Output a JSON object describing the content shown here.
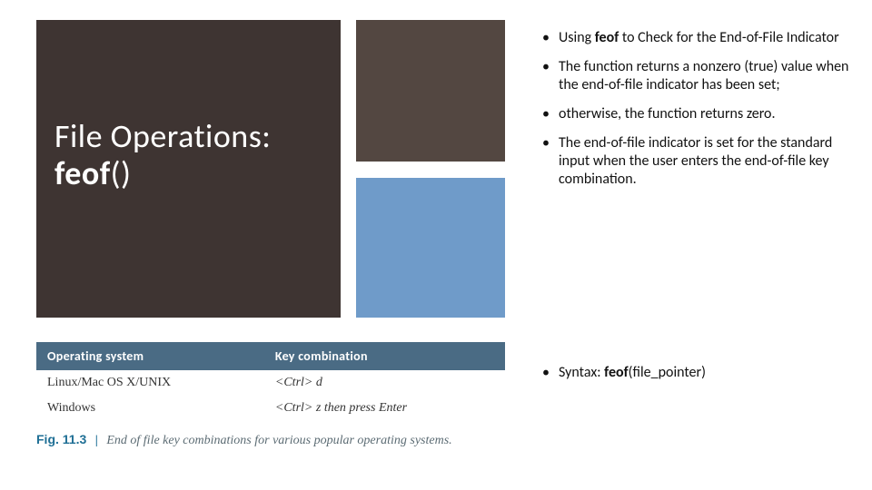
{
  "title": {
    "line1": "File Operations:",
    "fn": "feof",
    "paren": "()"
  },
  "bullets": {
    "b1_pre": "Using ",
    "b1_strong": "feof",
    "b1_post": " to Check for the End-of-File Indicator",
    "b2": "The function returns a nonzero (true) value when the end-of-file indicator has been set;",
    "b3": " otherwise, the function returns zero.",
    "b4": "The end-of-file indicator is set for the standard input when the user enters the end-of-file key combination."
  },
  "syntax": {
    "label": "Syntax:",
    "fn": "feof",
    "arg": "(file_pointer)"
  },
  "table": {
    "headers": [
      "Operating system",
      "Key combination"
    ],
    "rows": [
      {
        "os": "Linux/Mac OS X/UNIX",
        "key_pre": "<Ctrl> ",
        "key_k": "d",
        "key_post": ""
      },
      {
        "os": "Windows",
        "key_pre": "<Ctrl> ",
        "key_k": "z",
        "key_post": " then press Enter"
      }
    ]
  },
  "caption": {
    "figno": "Fig. 11.3",
    "bar": "|",
    "text": "End of file key combinations for various popular operating systems."
  }
}
